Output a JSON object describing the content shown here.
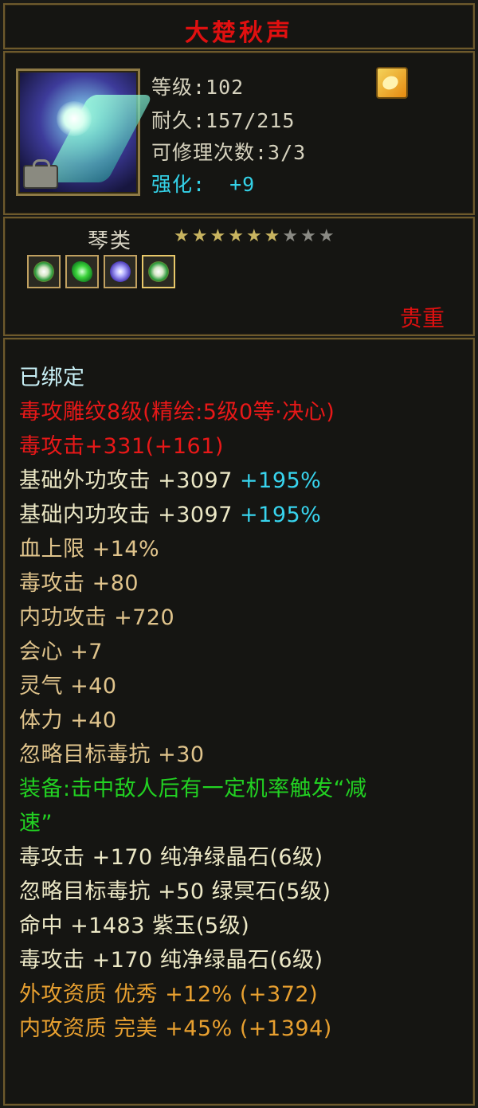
{
  "item": {
    "name": "大楚秋声",
    "stats": {
      "level": "等级:102",
      "durability": "耐久:157/215",
      "repairs": "可修理次数:3/3",
      "enhance_label": "强化:",
      "enhance_value": "+9"
    },
    "weapon_type": "琴类",
    "stars": {
      "lit": 6,
      "total": 9,
      "lit_color": "#c8b460",
      "unlit_color": "#8a8a84"
    },
    "gems": [
      "green-ring-gem-icon",
      "green-gem-icon",
      "purple-gem-icon",
      "green-ring-gem-icon"
    ],
    "rarity": "贵重",
    "icon": "weapon-zither-icon",
    "bind_icon": "lock-icon",
    "badge_icon": "gold-crest-icon"
  },
  "attributes": {
    "bound": "已绑定",
    "engraving": "毒攻雕纹8级(精绘:5级0等·决心)",
    "poison_attack_bonus": "毒攻击+331(+161)",
    "base_outer_label": "基础外功攻击 +3097",
    "base_outer_pct": "+195%",
    "base_inner_label": "基础内功攻击 +3097",
    "base_inner_pct": "+195%",
    "hp_cap": "血上限 +14%",
    "poison_attack": "毒攻击 +80",
    "inner_attack": "内功攻击 +720",
    "crit": "会心 +7",
    "spirit": "灵气 +40",
    "stamina": "体力 +40",
    "ignore_poison_res": "忽略目标毒抗 +30",
    "equip_effect_line1": "装备:击中敌人后有一定机率触发“减",
    "equip_effect_line2": "速”",
    "gem1": "毒攻击 +170 纯净绿晶石(6级)",
    "gem2": "忽略目标毒抗 +50 绿冥石(5级)",
    "gem3": "命中 +1483 紫玉(5级)",
    "gem4": "毒攻击 +170 纯净绿晶石(6级)",
    "outer_quality": "外攻资质  优秀 +12% (+372)",
    "inner_quality": "内攻资质  完美 +45% (+1394)"
  },
  "colors": {
    "title": "#e01010",
    "enhance": "#34d2e8",
    "rarity": "#e01010",
    "bound": "#c8f0f6",
    "engraving": "#e81818",
    "stat": "#ece8c6",
    "attr": "#e0c48c",
    "equip_effect": "#22d222",
    "quality": "#e8a030"
  }
}
